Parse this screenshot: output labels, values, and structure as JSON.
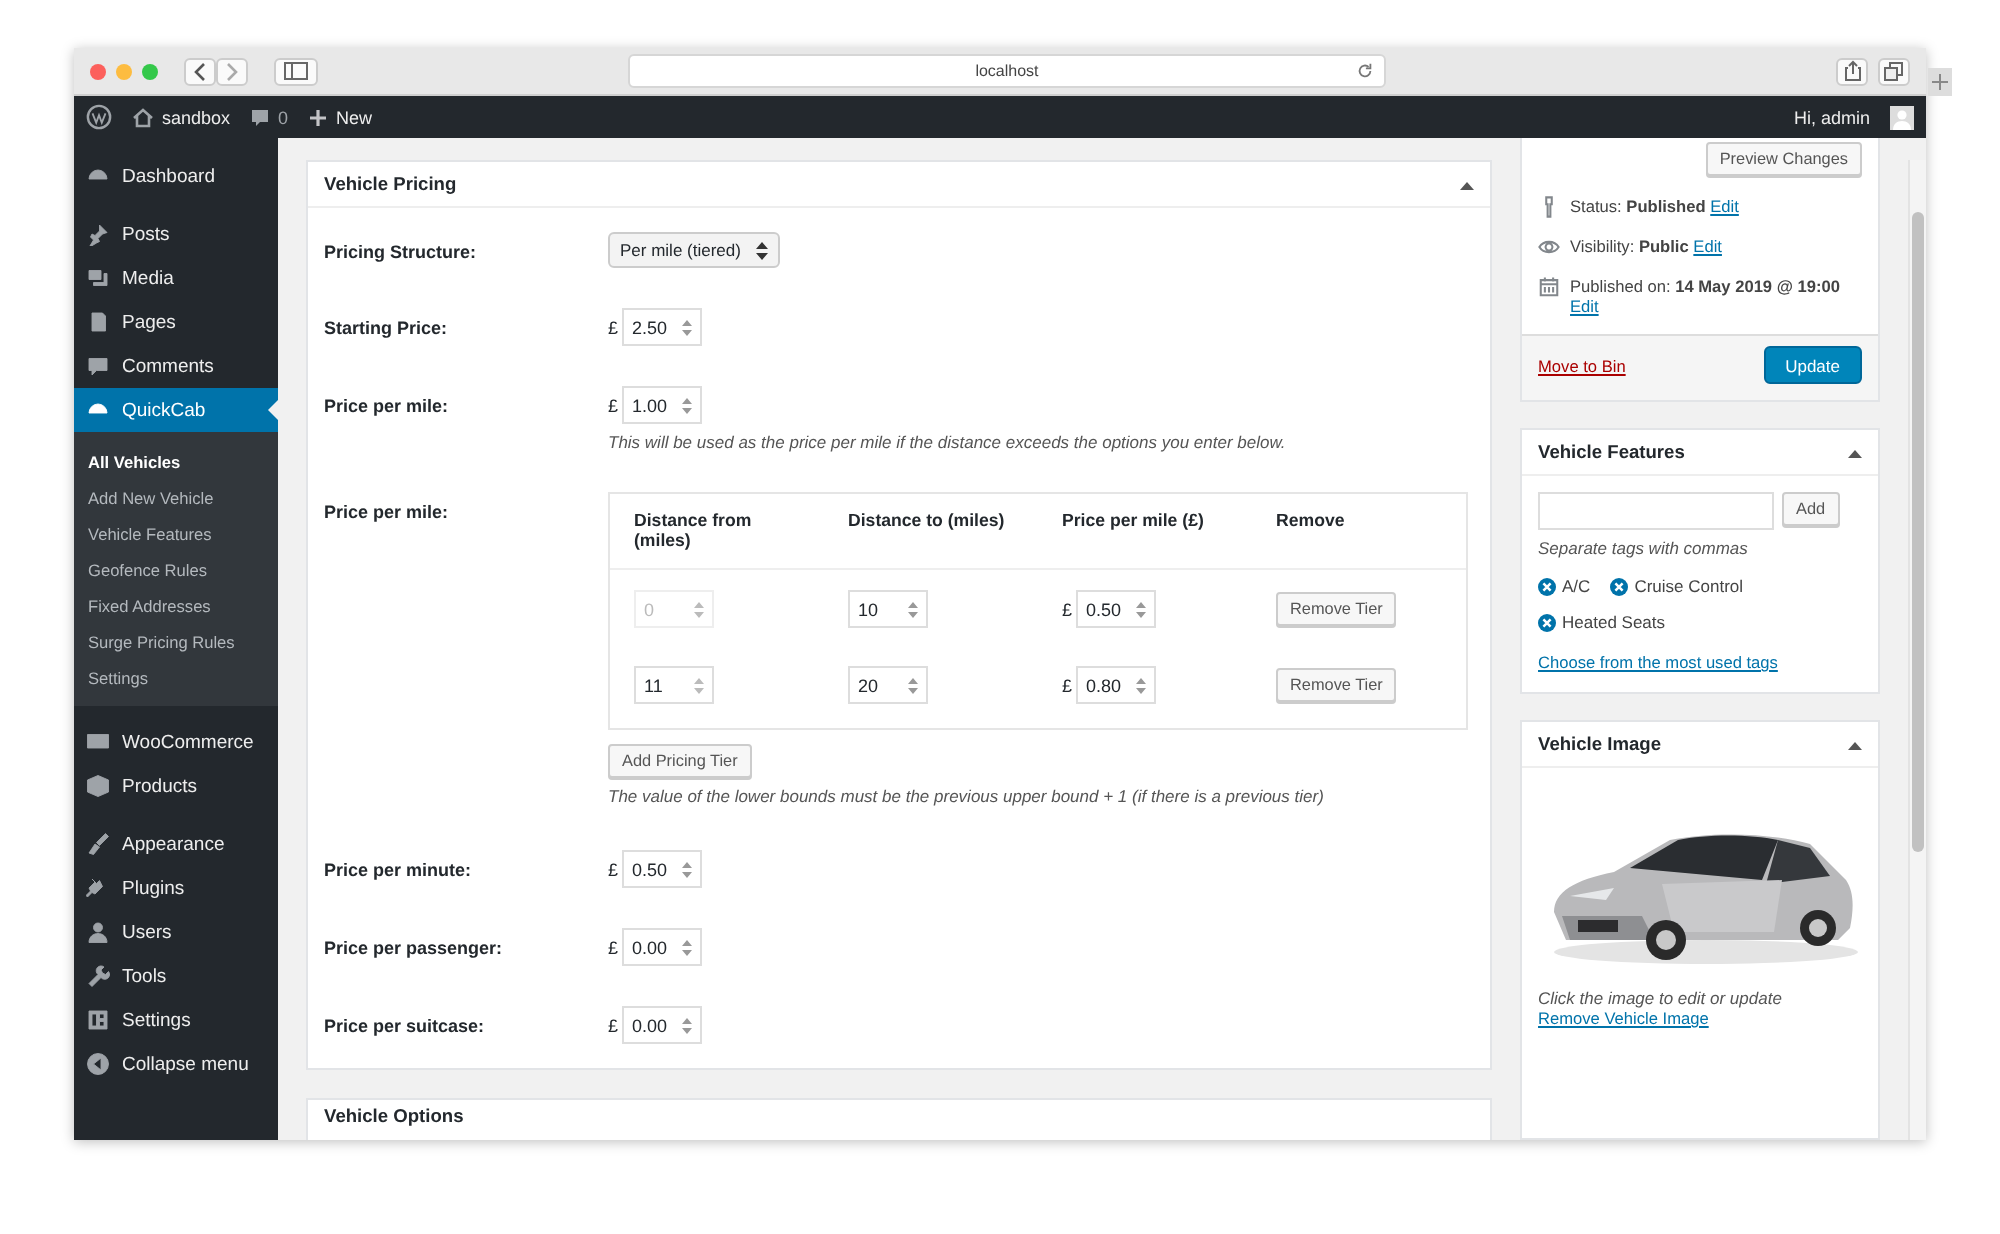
{
  "browser": {
    "url": "localhost"
  },
  "admin_bar": {
    "site": "sandbox",
    "comments": "0",
    "new": "New",
    "greeting": "Hi, admin"
  },
  "sidebar": {
    "groups": [
      {
        "items": [
          {
            "label": "Dashboard",
            "selected": false
          }
        ]
      },
      {
        "items": [
          {
            "label": "Posts",
            "selected": false
          },
          {
            "label": "Media",
            "selected": false
          },
          {
            "label": "Pages",
            "selected": false
          },
          {
            "label": "Comments",
            "selected": false
          },
          {
            "label": "QuickCab",
            "selected": true,
            "children": [
              {
                "label": "All Vehicles",
                "selected": true
              },
              {
                "label": "Add New Vehicle",
                "selected": false
              },
              {
                "label": "Vehicle Features",
                "selected": false
              },
              {
                "label": "Geofence Rules",
                "selected": false
              },
              {
                "label": "Fixed Addresses",
                "selected": false
              },
              {
                "label": "Surge Pricing Rules",
                "selected": false
              },
              {
                "label": "Settings",
                "selected": false
              }
            ]
          }
        ]
      },
      {
        "items": [
          {
            "label": "WooCommerce",
            "selected": false
          },
          {
            "label": "Products",
            "selected": false
          }
        ]
      },
      {
        "items": [
          {
            "label": "Appearance",
            "selected": false
          },
          {
            "label": "Plugins",
            "selected": false
          },
          {
            "label": "Users",
            "selected": false
          },
          {
            "label": "Tools",
            "selected": false
          },
          {
            "label": "Settings",
            "selected": false
          },
          {
            "label": "Collapse menu",
            "selected": false
          }
        ]
      }
    ]
  },
  "pricing_box": {
    "title": "Vehicle Pricing",
    "fields": [
      {
        "kind": "select",
        "label": "Pricing Structure:",
        "value": "Per mile (tiered)"
      },
      {
        "kind": "money",
        "label": "Starting Price:",
        "currency": "£",
        "value": "2.50"
      },
      {
        "kind": "money",
        "label": "Price per mile:",
        "currency": "£",
        "value": "1.00",
        "hint": "This will be used as the price per mile if the distance exceeds the options you enter below."
      },
      {
        "kind": "tiers",
        "label": "Price per mile:",
        "columns": [
          "Distance from (miles)",
          "Distance to (miles)",
          "Price per mile (£)",
          "Remove"
        ],
        "rows": [
          {
            "from": "0",
            "from_disabled": true,
            "to": "10",
            "currency": "£",
            "price": "0.50",
            "action": "Remove Tier"
          },
          {
            "from": "11",
            "from_disabled": false,
            "to": "20",
            "currency": "£",
            "price": "0.80",
            "action": "Remove Tier"
          }
        ],
        "add_button": "Add Pricing Tier",
        "hint": "The value of the lower bounds must be the previous upper bound + 1 (if there is a previous tier)"
      },
      {
        "kind": "money",
        "label": "Price per minute:",
        "currency": "£",
        "value": "0.50"
      },
      {
        "kind": "money",
        "label": "Price per passenger:",
        "currency": "£",
        "value": "0.00"
      },
      {
        "kind": "money",
        "label": "Price per suitcase:",
        "currency": "£",
        "value": "0.00"
      }
    ]
  },
  "options_box": {
    "title": "Vehicle Options"
  },
  "publish_box": {
    "preview_button": "Preview Changes",
    "rows": [
      {
        "kind": "status",
        "text": "Status: **Published**",
        "link": "Edit"
      },
      {
        "kind": "visibility",
        "text": "Visibility: **Public**",
        "link": "Edit"
      },
      {
        "kind": "date",
        "text": "Published on: **14 May 2019 @ 19:00**",
        "link": "Edit"
      }
    ],
    "trash_link": "Move to Bin",
    "update_button": "Update"
  },
  "features_box": {
    "title": "Vehicle Features",
    "add_button": "Add",
    "hint": "Separate tags with commas",
    "tags": [
      "A/C",
      "Cruise Control",
      "Heated Seats"
    ],
    "link": "Choose from the most used tags"
  },
  "image_box": {
    "title": "Vehicle Image",
    "hint": "Click the image to edit or update",
    "link": "Remove Vehicle Image"
  }
}
